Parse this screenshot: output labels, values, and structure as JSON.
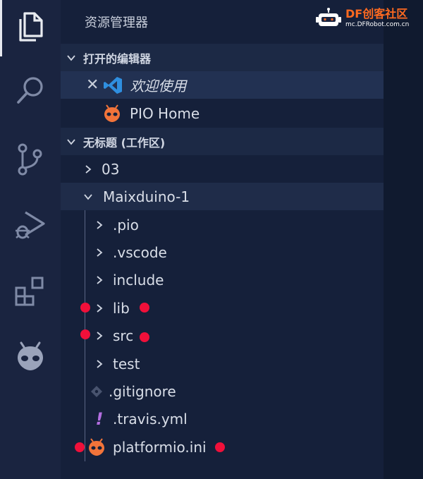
{
  "explorer": {
    "title": "资源管理器",
    "open_editors": {
      "label": "打开的编辑器",
      "items": [
        {
          "label": "欢迎使用"
        },
        {
          "label": "PIO Home"
        }
      ]
    },
    "workspace": {
      "label": "无标题 (工作区)",
      "folders": [
        {
          "label": "03"
        },
        {
          "label": "Maixduino-1"
        }
      ],
      "children": [
        {
          "label": ".pio"
        },
        {
          "label": ".vscode"
        },
        {
          "label": "include"
        },
        {
          "label": "lib"
        },
        {
          "label": "src"
        },
        {
          "label": "test"
        },
        {
          "label": ".gitignore"
        },
        {
          "label": ".travis.yml"
        },
        {
          "label": "platformio.ini"
        }
      ]
    }
  },
  "watermark": {
    "brand": "DF创客社区",
    "url": "mc.DFRobot.com.cn"
  },
  "colors": {
    "activity_bar": "#1a2440",
    "sidebar": "#15203a",
    "selection": "#223152",
    "annotation_dot": "#f0103a",
    "vscode_blue": "#2f8fe0",
    "pio_orange": "#f2743a"
  }
}
